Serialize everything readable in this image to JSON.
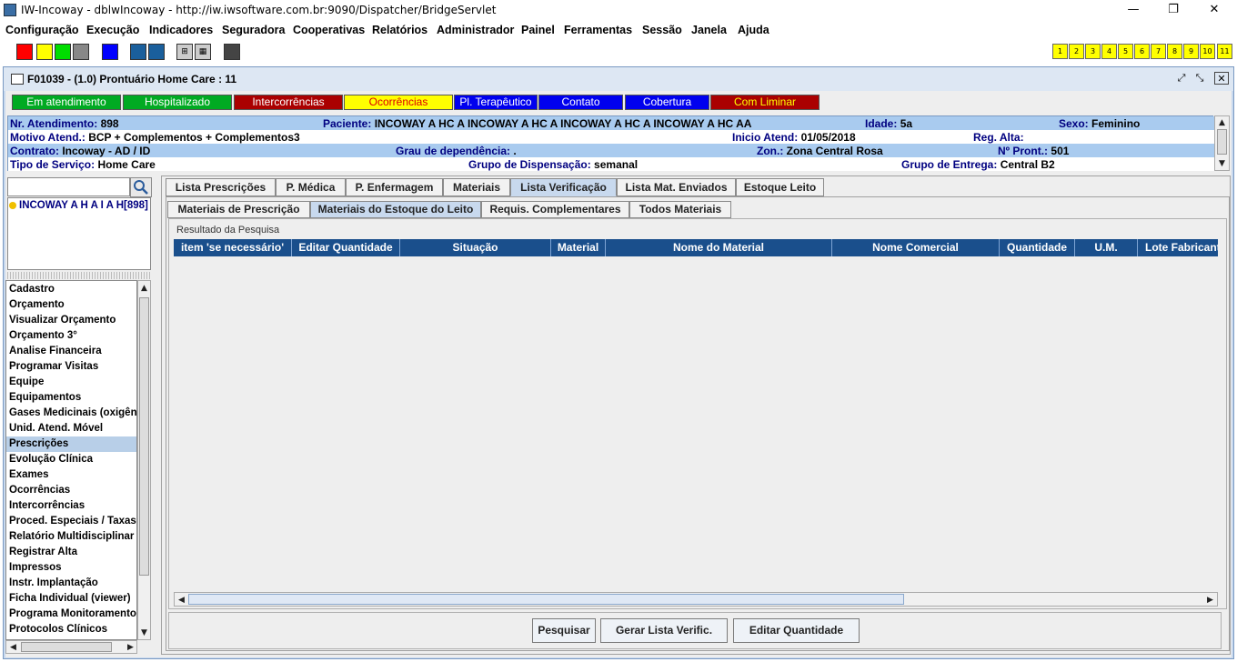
{
  "window": {
    "title": "IW-Incoway - dblwIncoway - http://iw.iwsoftware.com.br:9090/Dispatcher/BridgeServlet",
    "minimize": "—",
    "maximize": "❐",
    "close": "✕"
  },
  "menu": [
    "Configuração",
    "Execução",
    "Indicadores",
    "Seguradora",
    "Cooperativas",
    "Relatórios",
    "Administrador",
    "Painel",
    "Ferramentas",
    "Sessão",
    "Janela",
    "Ajuda"
  ],
  "toolbar": {
    "colors": [
      "#ff0000",
      "#ffff00",
      "#00dd00",
      "#888888",
      "#0000ff",
      "#1a5f9c",
      "#1a5f9c",
      "#cccccc",
      "#cccccc",
      "#444444"
    ],
    "numbers": [
      "1",
      "2",
      "3",
      "4",
      "5",
      "6",
      "7",
      "8",
      "9",
      "10",
      "11"
    ]
  },
  "frame": {
    "title": "F01039 - (1.0) Prontuário Home Care : 11",
    "restore": "⤢",
    "maximize": "⤡",
    "close": "✕"
  },
  "status_buttons": [
    {
      "label": "Em atendimento",
      "bg": "#00aa22",
      "fg": "#ffffff"
    },
    {
      "label": "Hospitalizado",
      "bg": "#00aa22",
      "fg": "#ffffff"
    },
    {
      "label": "Intercorrências",
      "bg": "#aa0000",
      "fg": "#ffffff"
    },
    {
      "label": "Ocorrências",
      "bg": "#ffff00",
      "fg": "#dd0000"
    },
    {
      "label": "Pl. Terapêutico",
      "bg": "#0000ee",
      "fg": "#ffffff"
    },
    {
      "label": "Contato",
      "bg": "#0000ee",
      "fg": "#ffffff"
    },
    {
      "label": "Cobertura",
      "bg": "#0000ee",
      "fg": "#ffffff"
    },
    {
      "label": "Com Liminar",
      "bg": "#aa0000",
      "fg": "#ffff00"
    }
  ],
  "info": {
    "nr_atendimento_k": "Nr. Atendimento:",
    "nr_atendimento_v": "898",
    "paciente_k": "Paciente:",
    "paciente_v": "INCOWAY A HC A INCOWAY A HC A INCOWAY A HC A INCOWAY A HC AA",
    "idade_k": "Idade:",
    "idade_v": "5a",
    "sexo_k": "Sexo:",
    "sexo_v": "Feminino",
    "motivo_k": "Motivo Atend.:",
    "motivo_v": "BCP + Complementos + Complementos3",
    "inicio_k": "Inicio Atend:",
    "inicio_v": "01/05/2018",
    "regalta_k": "Reg. Alta:",
    "regalta_v": "",
    "contrato_k": "Contrato:",
    "contrato_v": "Incoway - AD / ID",
    "grau_k": "Grau de dependência:",
    "grau_v": ".",
    "zon_k": "Zon.:",
    "zon_v": "Zona Central Rosa",
    "pront_k": "Nº Pront.:",
    "pront_v": "501",
    "tipo_k": "Tipo de Serviço:",
    "tipo_v": "Home Care",
    "grupo_disp_k": "Grupo de Dispensação:",
    "grupo_disp_v": "semanal",
    "grupo_ent_k": "Grupo de Entrega:",
    "grupo_ent_v": "Central B2"
  },
  "search": {
    "value": "",
    "placeholder": ""
  },
  "tree": {
    "item": "INCOWAY A H A I A H[898]"
  },
  "nav": [
    "Cadastro",
    "Orçamento",
    "Visualizar Orçamento",
    "Orçamento 3°",
    "Analise Financeira",
    "Programar Visitas",
    "Equipe",
    "Equipamentos",
    "Gases Medicinais (oxigênio)",
    "Unid. Atend. Móvel",
    "Prescrições",
    "Evolução Clínica",
    "Exames",
    "Ocorrências",
    "Intercorrências",
    "Proced. Especiais / Taxas",
    "Relatório Multidisciplinar",
    "Registrar Alta",
    "Impressos",
    "Instr. Implantação",
    "Ficha Individual (viewer)",
    "Programa Monitoramento",
    "Protocolos Clínicos"
  ],
  "nav_selected_index": 10,
  "tabs": [
    "Lista Prescrições",
    "P. Médica",
    "P. Enfermagem",
    "Materiais",
    "Lista Verificação",
    "Lista Mat. Enviados",
    "Estoque Leito"
  ],
  "tabs_active": 4,
  "subtabs": [
    "Materiais de Prescrição",
    "Materiais do Estoque do Leito",
    "Requis. Complementares",
    "Todos Materiais"
  ],
  "subtabs_active": 1,
  "result": {
    "title": "Resultado da Pesquisa",
    "columns": [
      "item 'se necessário'",
      "Editar Quantidade",
      "Situação",
      "Material",
      "Nome do Material",
      "Nome Comercial",
      "Quantidade",
      "U.M.",
      "Lote Fabricante"
    ],
    "rows": []
  },
  "actions": {
    "pesquisar": "Pesquisar",
    "gerar": "Gerar Lista Verific.",
    "editar": "Editar Quantidade"
  }
}
